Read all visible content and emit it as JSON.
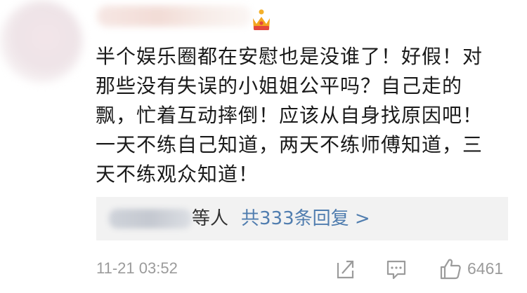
{
  "comment": {
    "lines": [
      "半个娱乐圈都在安慰也是没谁了！好假！对",
      "那些没有失误的小姐姐公平吗？自己走的",
      "飘，忙着互动摔倒！应该从自身找原因吧！",
      "一天不练自己知道，两天不练师傅知道，三",
      "天不练观众知道！"
    ]
  },
  "replies": {
    "suffix": "等人",
    "link_text": "共333条回复 >"
  },
  "footer": {
    "timestamp": "11-21 03:52",
    "like_count": "6461"
  },
  "icons": {
    "badge": "crown-icon",
    "share": "share-icon",
    "comment": "comment-icon",
    "like": "thumbs-up-icon"
  },
  "colors": {
    "text": "#1a1a1a",
    "link": "#507daf",
    "meta": "#9b9b9b",
    "reply_bg": "#f2f2f2",
    "crown": "#f0a020"
  }
}
